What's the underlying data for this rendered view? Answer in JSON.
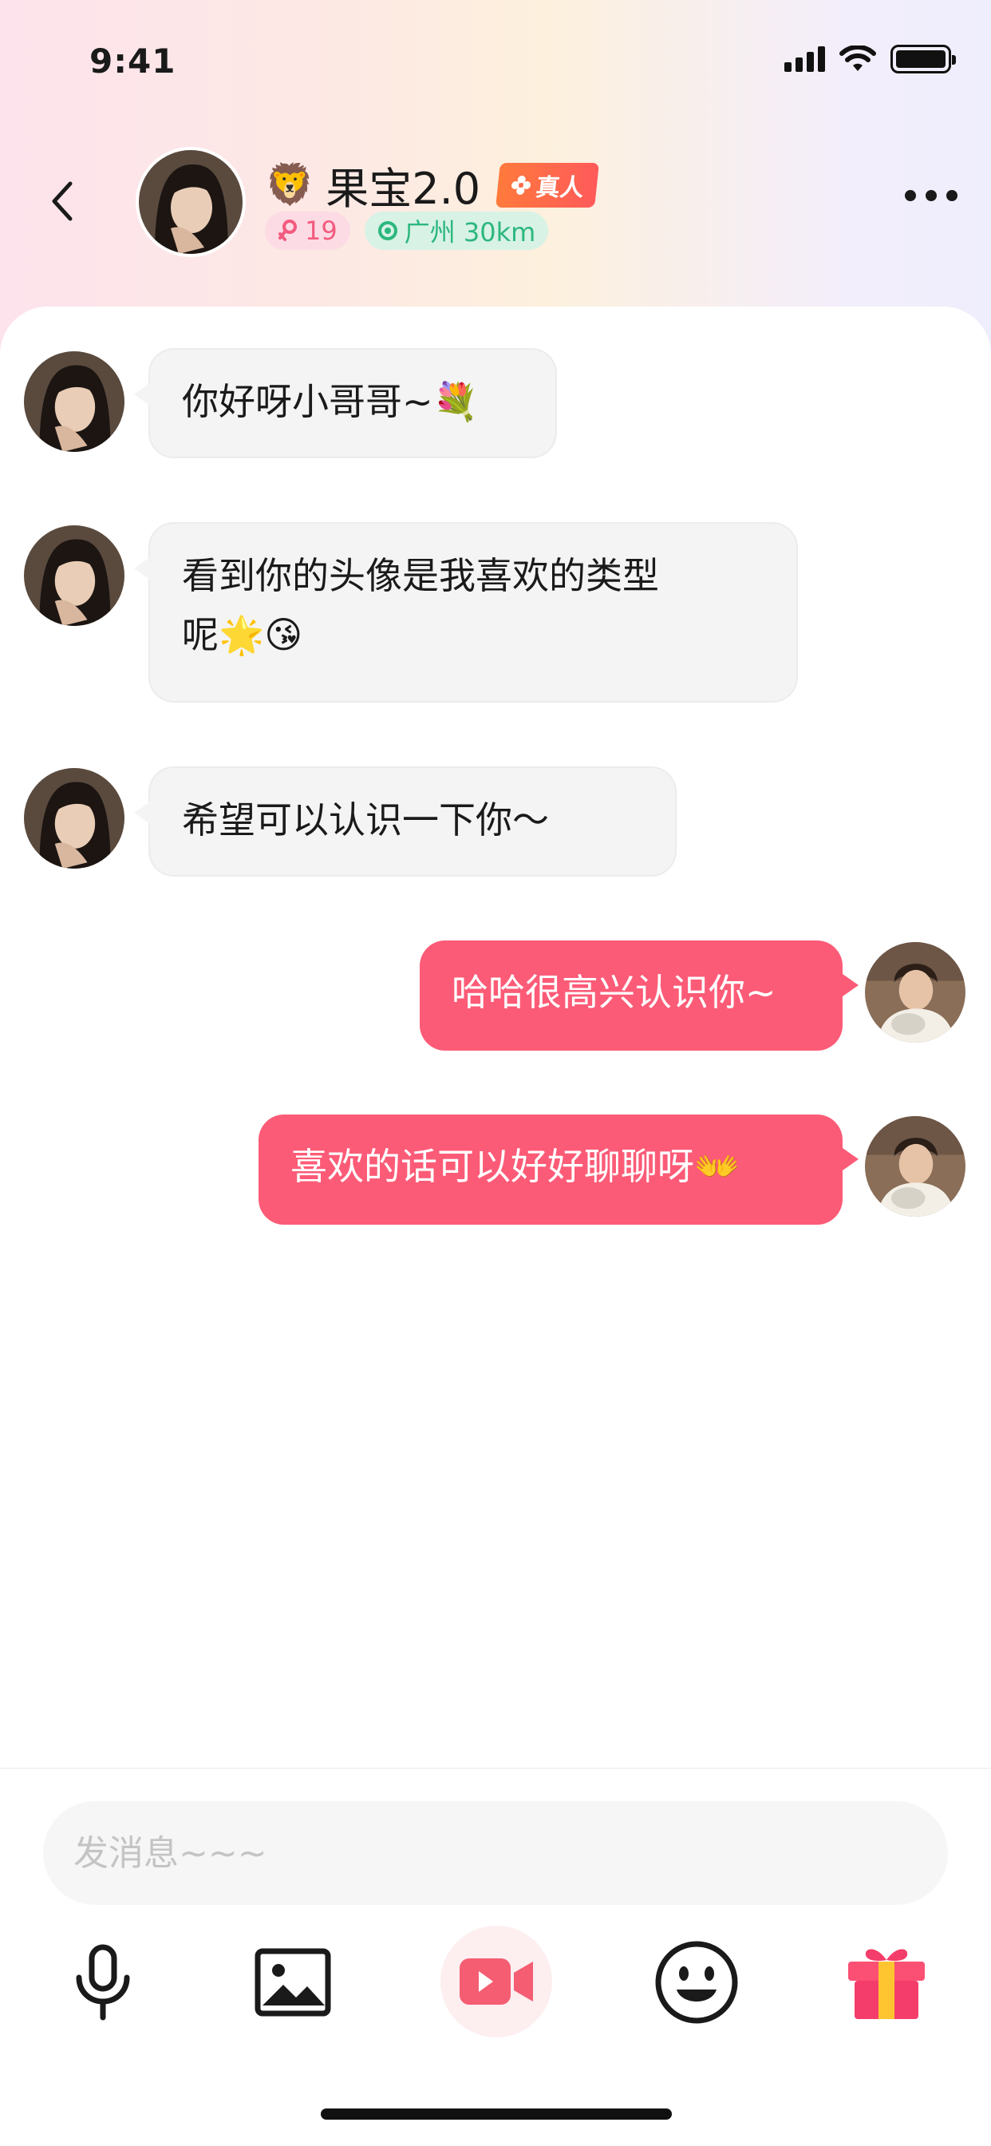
{
  "status_bar": {
    "time": "9:41"
  },
  "header": {
    "name_emoji": "🦁",
    "name": "果宝2.0",
    "real_badge": "真人",
    "age": "19",
    "location": "广州 30km"
  },
  "messages": [
    {
      "from": "other",
      "text": "你好呀小哥哥~💐"
    },
    {
      "from": "other",
      "text_line1": "看到你的头像是我喜欢的类型",
      "text_line2": "呢🌟😘"
    },
    {
      "from": "other",
      "text": "希望可以认识一下你～"
    },
    {
      "from": "me",
      "text": "哈哈很高兴认识你~"
    },
    {
      "from": "me",
      "text": "喜欢的话可以好好聊聊呀👐"
    }
  ],
  "input": {
    "placeholder": "发消息~~~"
  },
  "toolbar": [
    "microphone-icon",
    "image-icon",
    "video-call-icon",
    "emoji-icon",
    "gift-icon"
  ],
  "colors": {
    "accent": "#fc5b77",
    "incoming_bubble": "#f4f4f4",
    "location_tag": "#2db77e",
    "age_tag": "#f25b7e"
  }
}
